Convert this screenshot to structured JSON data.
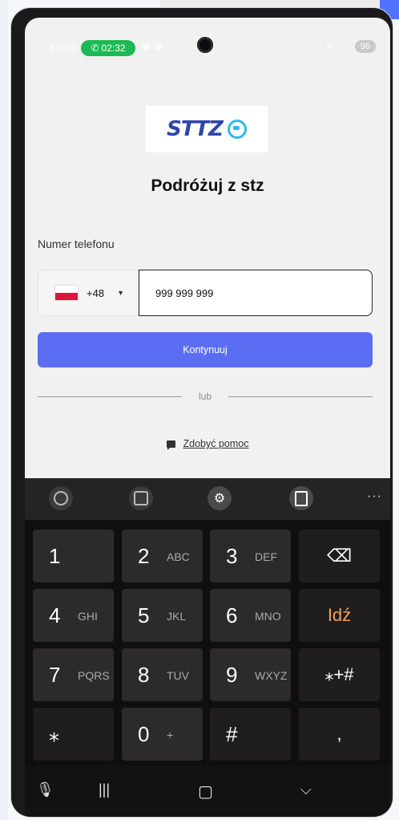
{
  "status_bar": {
    "time": "13:20",
    "call_timer": "02:32",
    "battery": "96"
  },
  "app": {
    "logo_text": "STTZ",
    "headline": "Podróżuj z stz",
    "phone_label": "Numer telefonu",
    "country_code": "+48",
    "phone_value": "999 999 999",
    "continue_label": "Kontynuuj",
    "divider_text": "lub",
    "help_label": "Zdobyć pomoc"
  },
  "keyboard": {
    "keys": [
      {
        "num": "1",
        "sub": ""
      },
      {
        "num": "2",
        "sub": "ABC"
      },
      {
        "num": "3",
        "sub": "DEF"
      },
      {
        "num": "4",
        "sub": "GHI"
      },
      {
        "num": "5",
        "sub": "JKL"
      },
      {
        "num": "6",
        "sub": "MNO"
      },
      {
        "num": "7",
        "sub": "PQRS"
      },
      {
        "num": "8",
        "sub": "TUV"
      },
      {
        "num": "9",
        "sub": "WXYZ"
      },
      {
        "num": "⁎",
        "sub": ""
      },
      {
        "num": "0",
        "sub": "+"
      },
      {
        "num": "#",
        "sub": ""
      }
    ],
    "go_label": "Idź",
    "symbols_label": "⁎+#",
    "comma_label": ",",
    "more_label": "···"
  },
  "icons": {
    "backspace": "backspace-icon",
    "emoji": "emoji-icon",
    "sticker": "sticker-icon",
    "settings": "gear-icon",
    "clipboard": "clipboard-icon",
    "mic": "microphone-icon"
  },
  "colors": {
    "primary_button": "#5b6ef3",
    "call_pill": "#1db954",
    "go_key": "#f5a15b"
  }
}
